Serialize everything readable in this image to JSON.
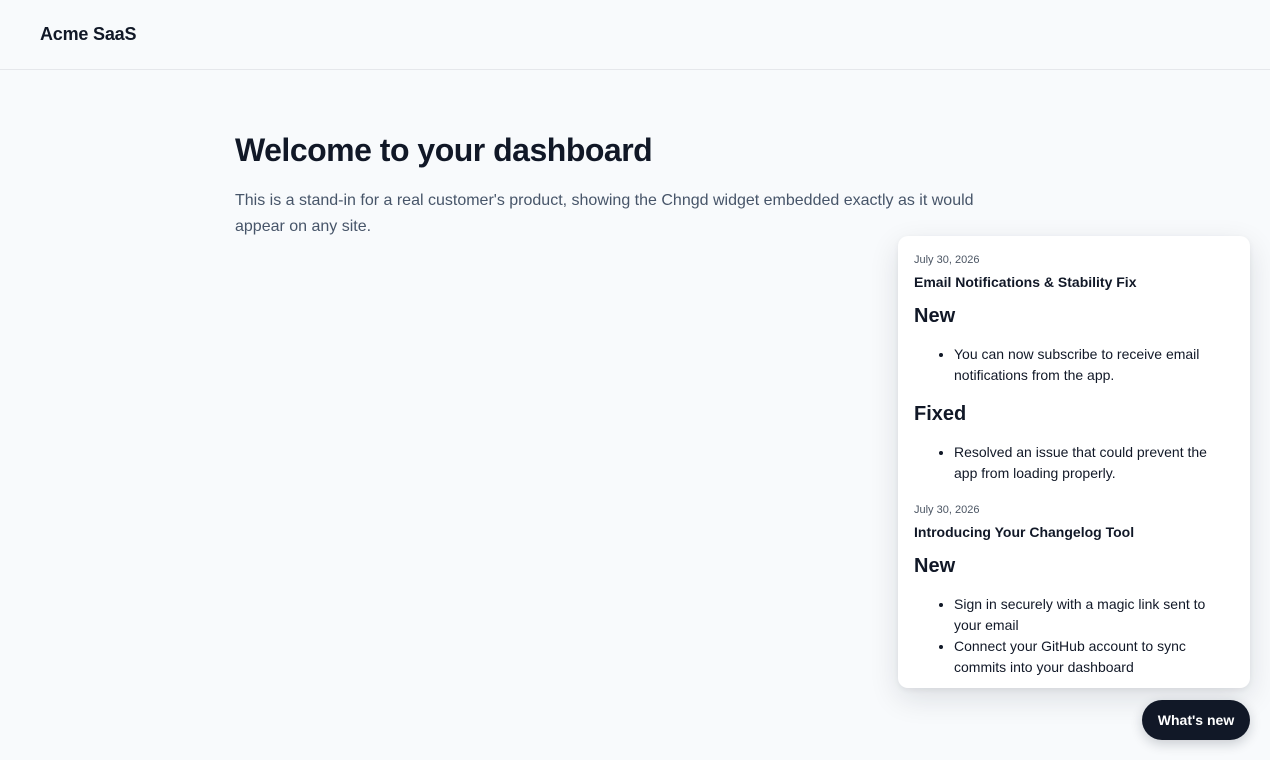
{
  "header": {
    "brand": "Acme SaaS"
  },
  "main": {
    "title": "Welcome to your dashboard",
    "description": "This is a stand-in for a real customer's product, showing the Chngd widget embedded exactly as it would appear on any site."
  },
  "widget": {
    "entries": [
      {
        "date": "July 30, 2026",
        "title": "Email Notifications & Stability Fix",
        "sections": [
          {
            "heading": "New",
            "items": [
              "You can now subscribe to receive email notifications from the app."
            ]
          },
          {
            "heading": "Fixed",
            "items": [
              "Resolved an issue that could prevent the app from loading properly."
            ]
          }
        ]
      },
      {
        "date": "July 30, 2026",
        "title": "Introducing Your Changelog Tool",
        "sections": [
          {
            "heading": "New",
            "items": [
              "Sign in securely with a magic link sent to your email",
              "Connect your GitHub account to sync commits into your dashboard"
            ]
          }
        ]
      }
    ]
  },
  "launcher": {
    "label": "What's new"
  }
}
